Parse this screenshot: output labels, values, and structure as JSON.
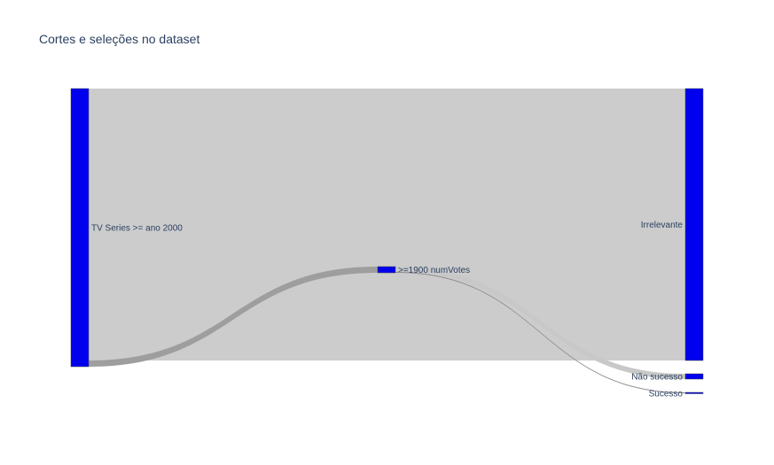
{
  "chart_data": {
    "type": "sankey",
    "title": "Cortes e seleções no dataset",
    "nodes": [
      {
        "id": "tv",
        "label": "TV Series >= ano 2000"
      },
      {
        "id": "votes",
        "label": ">=1900 numVotes"
      },
      {
        "id": "irrelevante",
        "label": "Irrelevante"
      },
      {
        "id": "nao_sucesso",
        "label": "Não sucesso"
      },
      {
        "id": "sucesso",
        "label": "Sucesso"
      }
    ],
    "links": [
      {
        "source": "tv",
        "target": "irrelevante",
        "value": 3070
      },
      {
        "source": "tv",
        "target": "votes",
        "value": 70
      },
      {
        "source": "votes",
        "target": "nao_sucesso",
        "value": 60
      },
      {
        "source": "votes",
        "target": "sucesso",
        "value": 10
      }
    ],
    "colors": {
      "node": "#0000ee",
      "link_main": "#cccccc",
      "link_secondary": "#9e9e9e",
      "link_nao_sucesso": "#c8c8c8",
      "link_sucesso": "#8c8c8c"
    }
  }
}
